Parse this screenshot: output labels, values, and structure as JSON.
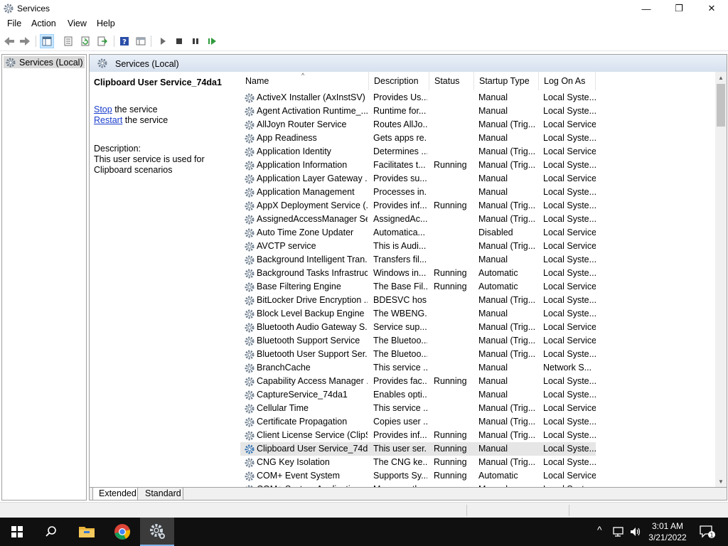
{
  "window": {
    "title": "Services",
    "icon": "gear-icon",
    "controls": {
      "minimize": "—",
      "maximize": "❐",
      "close": "✕"
    }
  },
  "menu": [
    "File",
    "Action",
    "View",
    "Help"
  ],
  "toolbar": {
    "icons": [
      "back-icon",
      "forward-icon",
      "show-tree-icon",
      "properties-icon",
      "refresh-icon",
      "export-icon",
      "help-icon",
      "console-icon",
      "start-icon",
      "stop-icon",
      "pause-icon",
      "restart-icon"
    ]
  },
  "tree": {
    "root_label": "Services (Local)"
  },
  "panel": {
    "header_title": "Services (Local)",
    "selected_service": "Clipboard User Service_74da1",
    "stop_link": "Stop",
    "stop_suffix": " the service",
    "restart_link": "Restart",
    "restart_suffix": " the service",
    "description_label": "Description:",
    "description_text": "This user service is used for Clipboard scenarios"
  },
  "columns": {
    "name": "Name",
    "description": "Description",
    "status": "Status",
    "startup": "Startup Type",
    "logon": "Log On As",
    "sort_indicator": "^"
  },
  "rows": [
    {
      "name": "ActiveX Installer (AxInstSV)",
      "description": "Provides Us...",
      "status": "",
      "startup": "Manual",
      "logon": "Local Syste..."
    },
    {
      "name": "Agent Activation Runtime_...",
      "description": "Runtime for...",
      "status": "",
      "startup": "Manual",
      "logon": "Local Syste..."
    },
    {
      "name": "AllJoyn Router Service",
      "description": "Routes AllJo...",
      "status": "",
      "startup": "Manual (Trig...",
      "logon": "Local Service"
    },
    {
      "name": "App Readiness",
      "description": "Gets apps re...",
      "status": "",
      "startup": "Manual",
      "logon": "Local Syste..."
    },
    {
      "name": "Application Identity",
      "description": "Determines ...",
      "status": "",
      "startup": "Manual (Trig...",
      "logon": "Local Service"
    },
    {
      "name": "Application Information",
      "description": "Facilitates t...",
      "status": "Running",
      "startup": "Manual (Trig...",
      "logon": "Local Syste..."
    },
    {
      "name": "Application Layer Gateway ...",
      "description": "Provides su...",
      "status": "",
      "startup": "Manual",
      "logon": "Local Service"
    },
    {
      "name": "Application Management",
      "description": "Processes in...",
      "status": "",
      "startup": "Manual",
      "logon": "Local Syste..."
    },
    {
      "name": "AppX Deployment Service (...",
      "description": "Provides inf...",
      "status": "Running",
      "startup": "Manual (Trig...",
      "logon": "Local Syste..."
    },
    {
      "name": "AssignedAccessManager Se...",
      "description": "AssignedAc...",
      "status": "",
      "startup": "Manual (Trig...",
      "logon": "Local Syste..."
    },
    {
      "name": "Auto Time Zone Updater",
      "description": "Automatica...",
      "status": "",
      "startup": "Disabled",
      "logon": "Local Service"
    },
    {
      "name": "AVCTP service",
      "description": "This is Audi...",
      "status": "",
      "startup": "Manual (Trig...",
      "logon": "Local Service"
    },
    {
      "name": "Background Intelligent Tran...",
      "description": "Transfers fil...",
      "status": "",
      "startup": "Manual",
      "logon": "Local Syste..."
    },
    {
      "name": "Background Tasks Infrastruc...",
      "description": "Windows in...",
      "status": "Running",
      "startup": "Automatic",
      "logon": "Local Syste..."
    },
    {
      "name": "Base Filtering Engine",
      "description": "The Base Fil...",
      "status": "Running",
      "startup": "Automatic",
      "logon": "Local Service"
    },
    {
      "name": "BitLocker Drive Encryption ...",
      "description": "BDESVC hos...",
      "status": "",
      "startup": "Manual (Trig...",
      "logon": "Local Syste..."
    },
    {
      "name": "Block Level Backup Engine ...",
      "description": "The WBENG...",
      "status": "",
      "startup": "Manual",
      "logon": "Local Syste..."
    },
    {
      "name": "Bluetooth Audio Gateway S...",
      "description": "Service sup...",
      "status": "",
      "startup": "Manual (Trig...",
      "logon": "Local Service"
    },
    {
      "name": "Bluetooth Support Service",
      "description": "The Bluetoo...",
      "status": "",
      "startup": "Manual (Trig...",
      "logon": "Local Service"
    },
    {
      "name": "Bluetooth User Support Ser...",
      "description": "The Bluetoo...",
      "status": "",
      "startup": "Manual (Trig...",
      "logon": "Local Syste..."
    },
    {
      "name": "BranchCache",
      "description": "This service ...",
      "status": "",
      "startup": "Manual",
      "logon": "Network S..."
    },
    {
      "name": "Capability Access Manager ...",
      "description": "Provides fac...",
      "status": "Running",
      "startup": "Manual",
      "logon": "Local Syste..."
    },
    {
      "name": "CaptureService_74da1",
      "description": "Enables opti...",
      "status": "",
      "startup": "Manual",
      "logon": "Local Syste..."
    },
    {
      "name": "Cellular Time",
      "description": "This service ...",
      "status": "",
      "startup": "Manual (Trig...",
      "logon": "Local Service"
    },
    {
      "name": "Certificate Propagation",
      "description": "Copies user ...",
      "status": "",
      "startup": "Manual (Trig...",
      "logon": "Local Syste..."
    },
    {
      "name": "Client License Service (ClipS...",
      "description": "Provides inf...",
      "status": "Running",
      "startup": "Manual (Trig...",
      "logon": "Local Syste..."
    },
    {
      "name": "Clipboard User Service_74da1",
      "description": "This user ser...",
      "status": "Running",
      "startup": "Manual",
      "logon": "Local Syste...",
      "selected": true
    },
    {
      "name": "CNG Key Isolation",
      "description": "The CNG ke...",
      "status": "Running",
      "startup": "Manual (Trig...",
      "logon": "Local Syste..."
    },
    {
      "name": "COM+ Event System",
      "description": "Supports Sy...",
      "status": "Running",
      "startup": "Automatic",
      "logon": "Local Service"
    },
    {
      "name": "COM+ System Application",
      "description": "Manages th...",
      "status": "",
      "startup": "Manual",
      "logon": "Local Syste..."
    }
  ],
  "tabs": [
    "Extended",
    "Standard"
  ],
  "taskbar": {
    "start": "windows-start-icon",
    "search": "search-icon",
    "items": [
      "file-explorer-icon",
      "chrome-icon",
      "services-icon"
    ],
    "tray": {
      "chevron": "^",
      "network": "network-icon",
      "volume": "volume-icon",
      "time": "3:01 AM",
      "date": "3/21/2022",
      "notifications_count": "1"
    }
  }
}
